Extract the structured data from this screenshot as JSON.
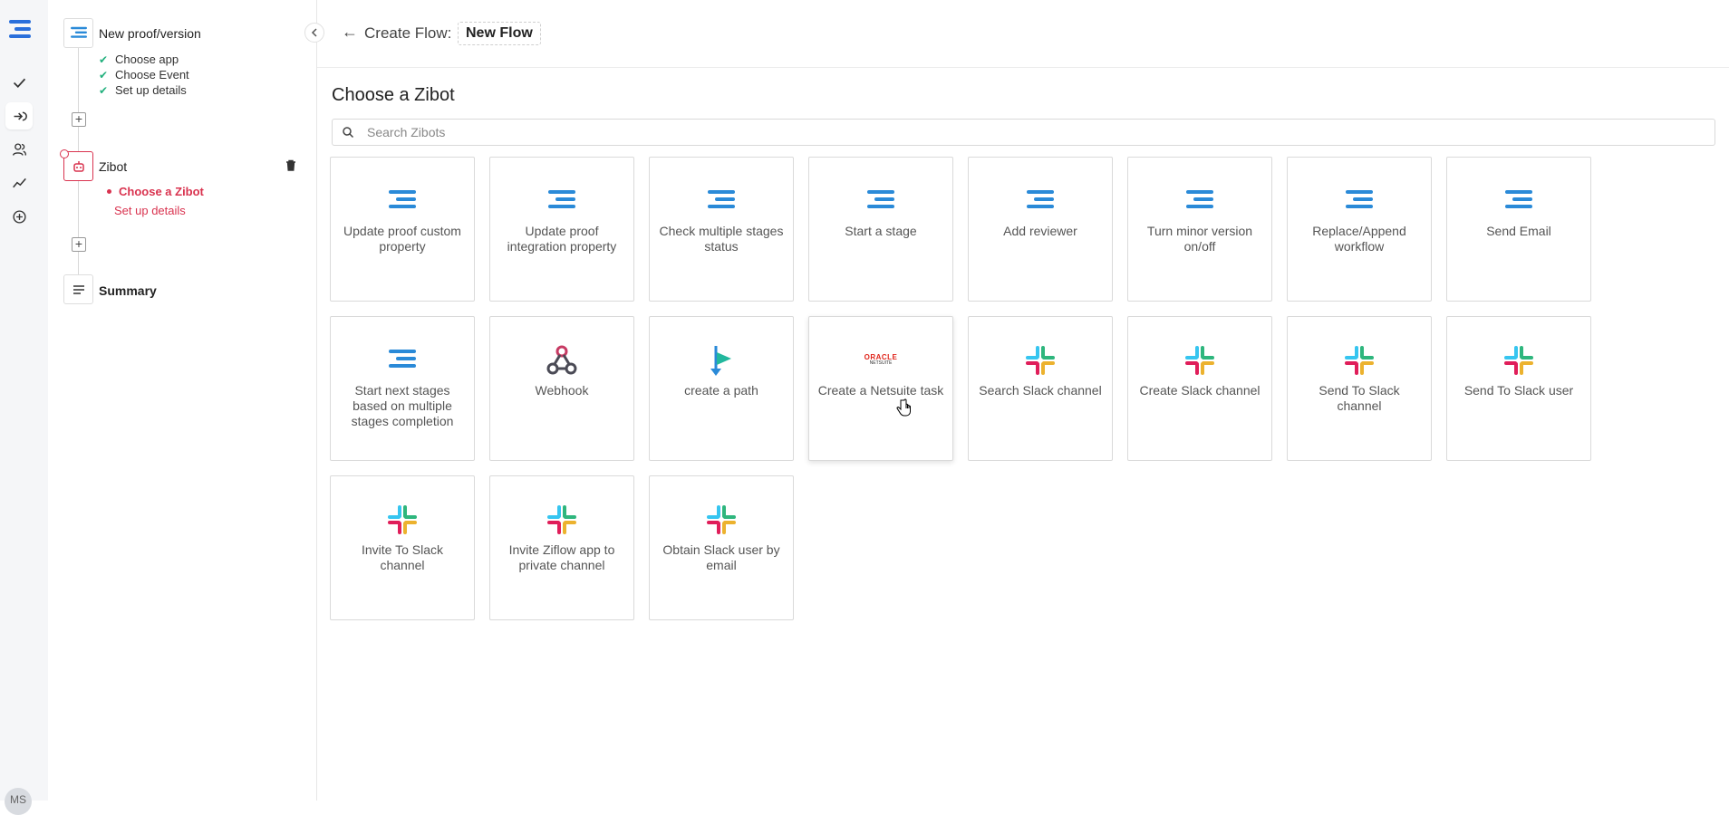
{
  "rail": {
    "avatar_initials": "MS",
    "items": [
      "approvals-check",
      "flows",
      "users",
      "analytics",
      "add"
    ]
  },
  "steps": {
    "trigger": {
      "title": "New proof/version",
      "substeps": [
        "Choose app",
        "Choose Event",
        "Set up details"
      ]
    },
    "action": {
      "title": "Zibot",
      "substeps": [
        "Choose a Zibot",
        "Set up details"
      ]
    },
    "summary": {
      "title": "Summary"
    }
  },
  "header": {
    "label": "Create Flow:",
    "flow_name": "New Flow"
  },
  "main": {
    "title": "Choose a Zibot",
    "search_placeholder": "Search Zibots",
    "cards": [
      {
        "label": "Update proof custom property",
        "icon": "ziflow-logo-icon"
      },
      {
        "label": "Update proof integration property",
        "icon": "ziflow-logo-icon"
      },
      {
        "label": "Check multiple stages status",
        "icon": "ziflow-logo-icon"
      },
      {
        "label": "Start a stage",
        "icon": "ziflow-logo-icon"
      },
      {
        "label": "Add reviewer",
        "icon": "ziflow-logo-icon"
      },
      {
        "label": "Turn minor version on/off",
        "icon": "ziflow-logo-icon"
      },
      {
        "label": "Replace/Append workflow",
        "icon": "ziflow-logo-icon"
      },
      {
        "label": "Send Email",
        "icon": "ziflow-logo-icon"
      },
      {
        "label": "Start next stages based on multiple stages completion",
        "icon": "ziflow-logo-icon"
      },
      {
        "label": "Webhook",
        "icon": "webhook-icon"
      },
      {
        "label": "create a path",
        "icon": "path-icon"
      },
      {
        "label": "Create a Netsuite task",
        "icon": "oracle-netsuite-icon"
      },
      {
        "label": "Search Slack channel",
        "icon": "slack-icon"
      },
      {
        "label": "Create Slack channel",
        "icon": "slack-icon"
      },
      {
        "label": "Send To Slack channel",
        "icon": "slack-icon"
      },
      {
        "label": "Send To Slack user",
        "icon": "slack-icon"
      },
      {
        "label": "Invite To Slack channel",
        "icon": "slack-icon"
      },
      {
        "label": "Invite Ziflow app to private channel",
        "icon": "slack-icon"
      },
      {
        "label": "Obtain Slack user by email",
        "icon": "slack-icon"
      }
    ],
    "oracle_logo": {
      "line1": "ORACLE",
      "line2": "NETSUITE"
    }
  },
  "colors": {
    "brand_blue": "#2a8ad8",
    "error_red": "#d9334f",
    "check_green": "#22b07d"
  }
}
